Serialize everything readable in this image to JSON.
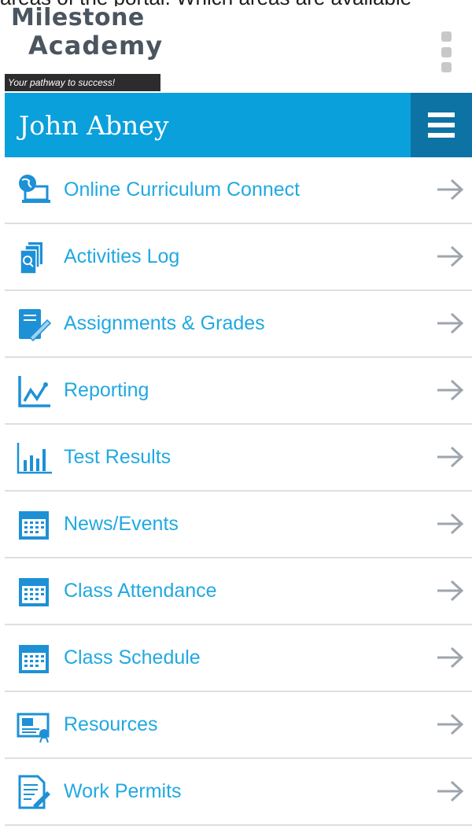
{
  "caption": "areas of the portal. Which areas are available",
  "logo": {
    "line1": "Milestone",
    "line2": "Academy",
    "tagline": "Your pathway to success!"
  },
  "header": {
    "user_name": "John Abney"
  },
  "icons": {
    "more": "more-vertical-icon",
    "menu": "hamburger-menu-icon",
    "arrow": "arrow-right-icon"
  },
  "colors": {
    "accent": "#0aa0dc",
    "accent_dark": "#0c73a4",
    "link": "#21a9e1",
    "icon": "#1e90d6"
  },
  "nav": {
    "items": [
      {
        "label": "Online Curriculum Connect",
        "icon": "globe-laptop-icon"
      },
      {
        "label": "Activities Log",
        "icon": "search-documents-icon"
      },
      {
        "label": "Assignments & Grades",
        "icon": "notebook-pencil-icon"
      },
      {
        "label": "Reporting",
        "icon": "line-chart-icon"
      },
      {
        "label": "Test Results",
        "icon": "bar-chart-icon"
      },
      {
        "label": "News/Events",
        "icon": "calendar-icon"
      },
      {
        "label": "Class Attendance",
        "icon": "calendar-icon"
      },
      {
        "label": "Class Schedule",
        "icon": "calendar-icon"
      },
      {
        "label": "Resources",
        "icon": "resources-certificate-icon"
      },
      {
        "label": "Work Permits",
        "icon": "document-pen-icon"
      }
    ]
  }
}
